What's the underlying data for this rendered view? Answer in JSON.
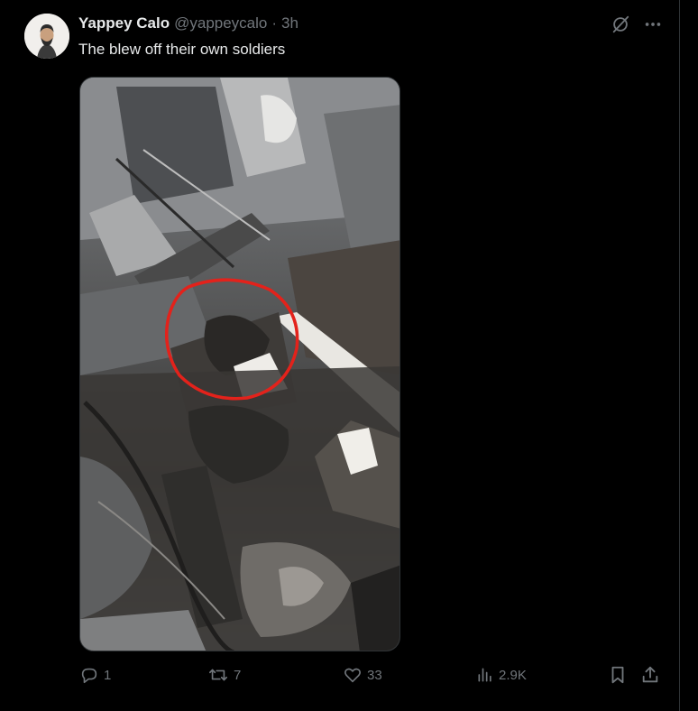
{
  "tweet": {
    "author_name": "Yappey Calo",
    "author_handle": "@yappeycalo",
    "separator": "·",
    "time": "3h",
    "text": "The blew off their own soldiers"
  },
  "stats": {
    "replies": "1",
    "reposts": "7",
    "likes": "33",
    "views": "2.9K"
  },
  "icons": {
    "grok": "grok-icon",
    "more": "more-icon",
    "reply": "reply-icon",
    "repost": "repost-icon",
    "like": "like-icon",
    "views": "views-icon",
    "bookmark": "bookmark-icon",
    "share": "share-icon"
  },
  "colors": {
    "background": "#000000",
    "text_primary": "#e7e9ea",
    "text_secondary": "#71767b",
    "border": "#2f3336",
    "annotation_circle": "#e3221b"
  }
}
